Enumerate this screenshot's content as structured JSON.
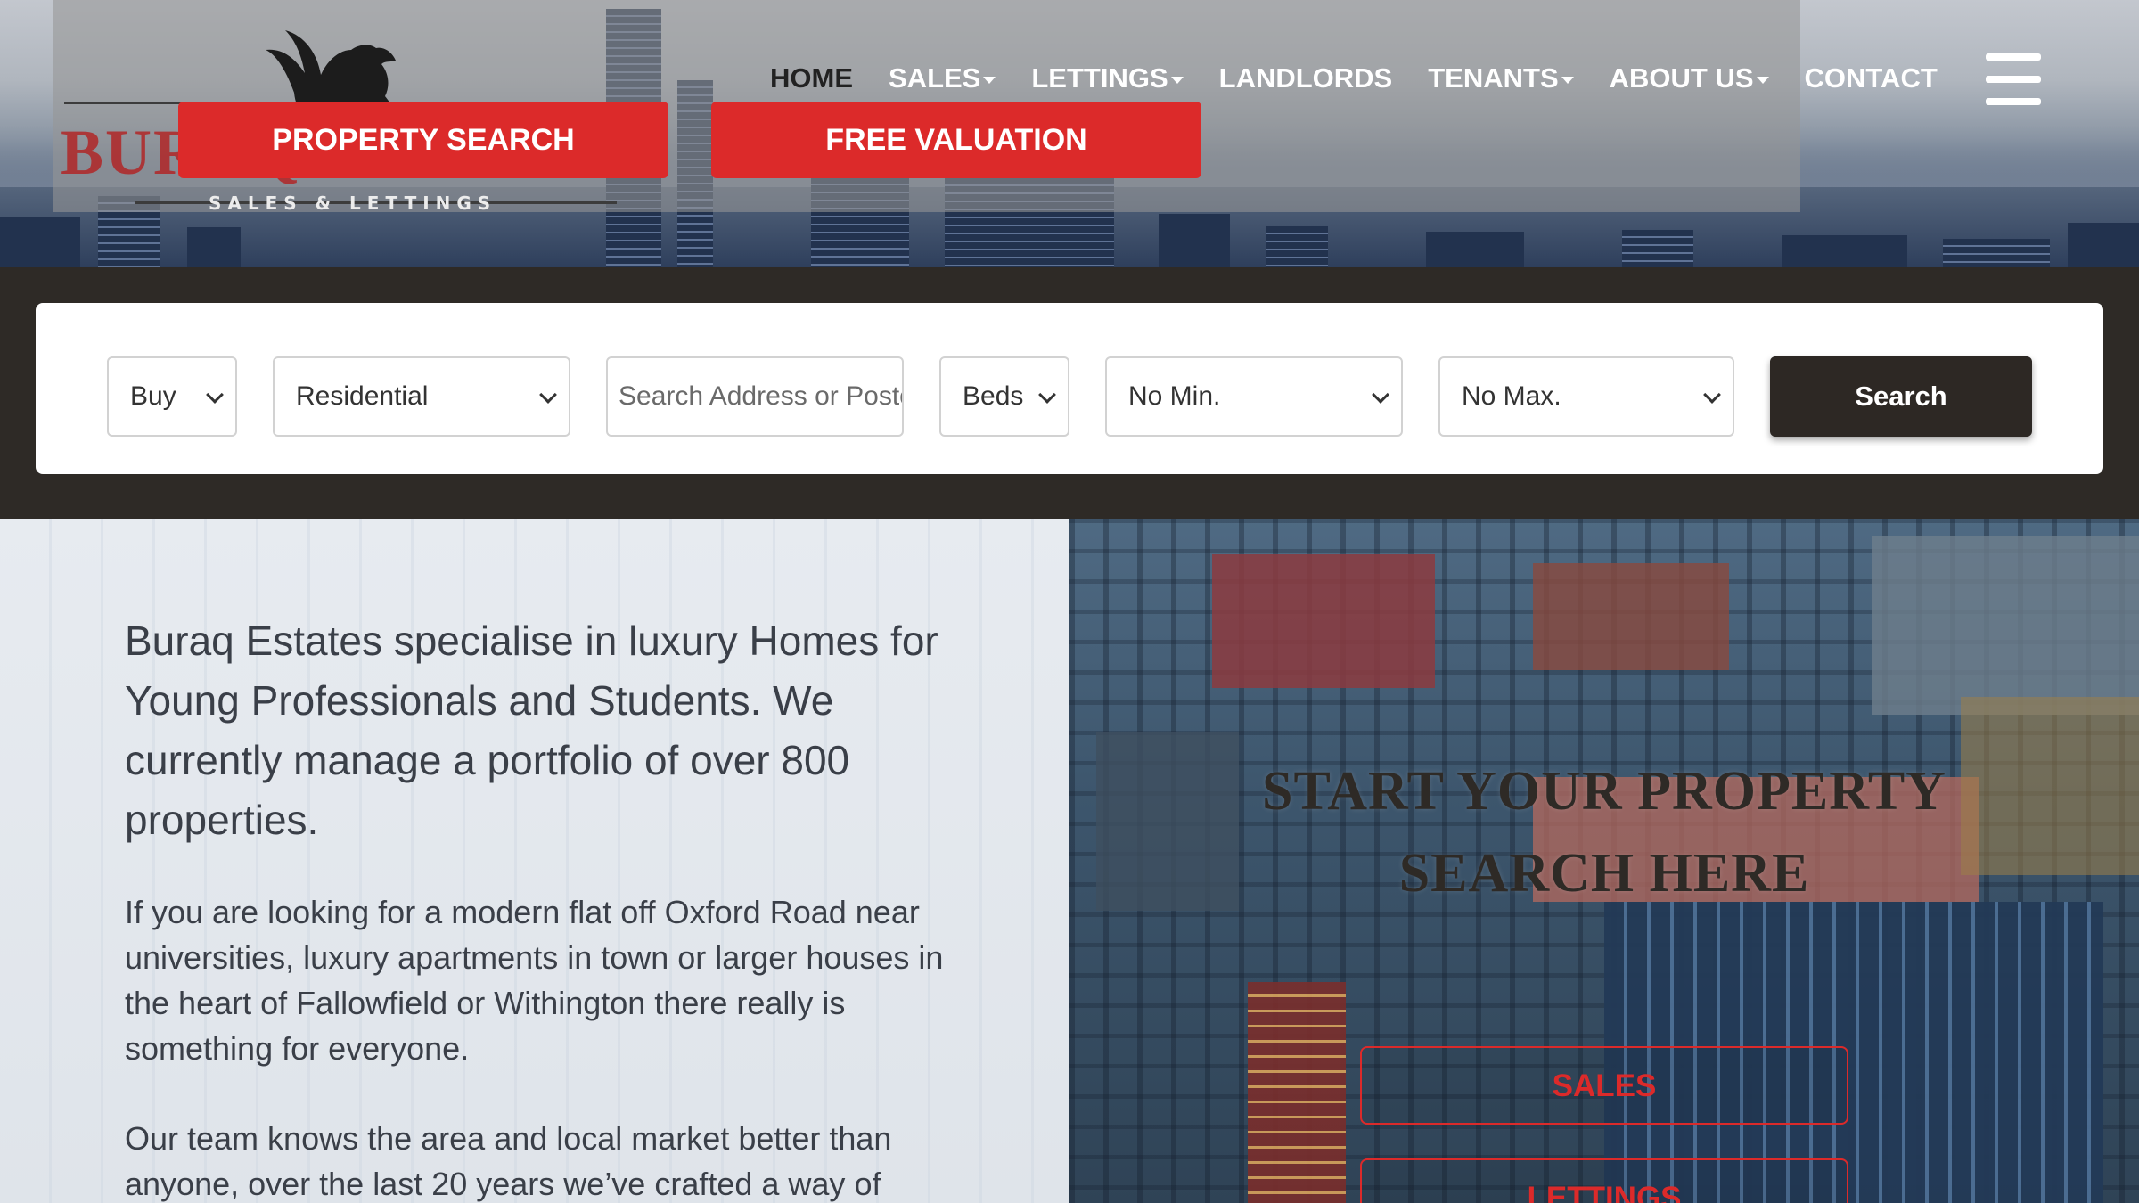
{
  "brand": {
    "logo_text": "BURAQ ESTATES",
    "tagline": "SALES & LETTINGS"
  },
  "header": {
    "property_search_label": "PROPERTY SEARCH",
    "free_valuation_label": "FREE VALUATION",
    "nav": [
      {
        "label": "HOME",
        "dropdown": false,
        "active": true
      },
      {
        "label": "SALES",
        "dropdown": true,
        "active": false
      },
      {
        "label": "LETTINGS",
        "dropdown": true,
        "active": false
      },
      {
        "label": "LANDLORDS",
        "dropdown": false,
        "active": false
      },
      {
        "label": "TENANTS",
        "dropdown": true,
        "active": false
      },
      {
        "label": "ABOUT US",
        "dropdown": true,
        "active": false
      },
      {
        "label": "CONTACT",
        "dropdown": false,
        "active": false
      }
    ],
    "menu_icon": "hamburger-icon"
  },
  "search": {
    "type": "Buy",
    "category": "Residential",
    "address_placeholder": "Search Address or Postcode",
    "beds": "Beds",
    "min_price": "No Min.",
    "max_price": "No Max.",
    "button_label": "Search"
  },
  "content": {
    "intro": "Buraq Estates specialise in luxury Homes for Young Professionals and Students. We currently manage a portfolio of over 800 properties.",
    "paragraph_1": "If you are looking for a modern flat off Oxford Road near universities, luxury apartments in town or larger houses in the heart of Fallowfield or Withington there really is something for everyone.",
    "paragraph_2": "Our team knows the area and local market better than anyone, over the last 20 years we’ve crafted a way of"
  },
  "cta": {
    "title": "Start your property search here",
    "sales_label": "SALES",
    "lettings_label": "LETTINGS"
  },
  "colors": {
    "accent_red": "#dc2a2a",
    "dark": "#2e2a26",
    "body_text": "#3a3f48"
  }
}
